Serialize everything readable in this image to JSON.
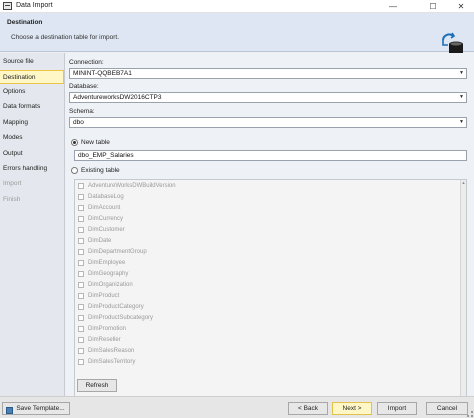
{
  "window": {
    "title": "Data Import"
  },
  "header": {
    "title": "Destination",
    "subtitle": "Choose a destination table for import."
  },
  "sidebar": {
    "items": [
      {
        "label": "Source file",
        "active": false,
        "disabled": false
      },
      {
        "label": "Destination",
        "active": true,
        "disabled": false
      },
      {
        "label": "Options",
        "active": false,
        "disabled": false
      },
      {
        "label": "Data formats",
        "active": false,
        "disabled": false
      },
      {
        "label": "Mapping",
        "active": false,
        "disabled": false
      },
      {
        "label": "Modes",
        "active": false,
        "disabled": false
      },
      {
        "label": "Output",
        "active": false,
        "disabled": false
      },
      {
        "label": "Errors handling",
        "active": false,
        "disabled": false
      },
      {
        "label": "Import",
        "active": false,
        "disabled": true
      },
      {
        "label": "Finish",
        "active": false,
        "disabled": true
      }
    ]
  },
  "form": {
    "connection_label": "Connection:",
    "connection_value": "MININT-QQBEB7A1",
    "database_label": "Database:",
    "database_value": "AdventureworksDW2016CTP3",
    "schema_label": "Schema:",
    "schema_value": "dbo",
    "new_table_label": "New table",
    "new_table_value": "dbo_EMP_Salaries",
    "existing_table_label": "Existing table",
    "tables": [
      "AdventureWorksDWBuildVersion",
      "DatabaseLog",
      "DimAccount",
      "DimCurrency",
      "DimCustomer",
      "DimDate",
      "DimDepartmentGroup",
      "DimEmployee",
      "DimGeography",
      "DimOrganization",
      "DimProduct",
      "DimProductCategory",
      "DimProductSubcategory",
      "DimPromotion",
      "DimReseller",
      "DimSalesReason",
      "DimSalesTerritory"
    ],
    "refresh_label": "Refresh"
  },
  "footer": {
    "save_template_label": "Save Template...",
    "back_label": "< Back",
    "next_label": "Next >",
    "import_label": "Import",
    "cancel_label": "Cancel"
  },
  "icons": {
    "app": "data-import-icon",
    "destination": "database-refresh-icon",
    "save": "floppy-disk-icon"
  },
  "colors": {
    "active_nav": "#fff7c6",
    "header_bg": "#dde6f2",
    "accent_blue": "#1c6fb8"
  }
}
